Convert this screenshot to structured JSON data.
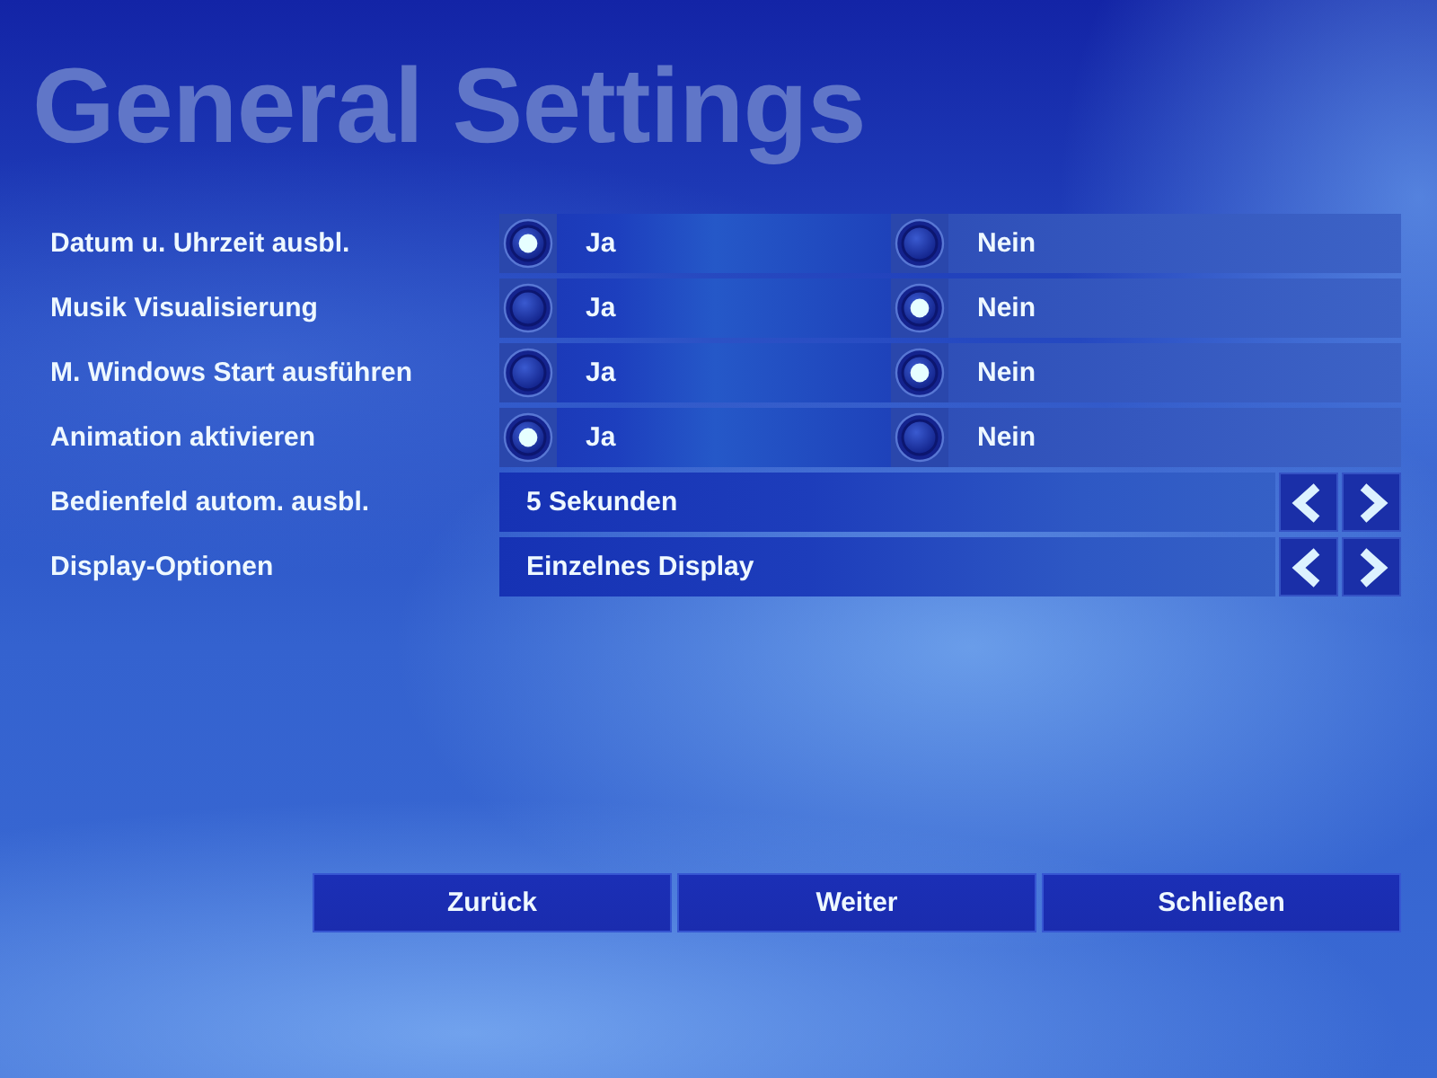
{
  "title": "General Settings",
  "settings": [
    {
      "kind": "radio",
      "label": "Datum u. Uhrzeit ausbl.",
      "options": [
        {
          "label": "Ja",
          "selected": true
        },
        {
          "label": "Nein",
          "selected": false
        }
      ]
    },
    {
      "kind": "radio",
      "label": "Musik Visualisierung",
      "options": [
        {
          "label": "Ja",
          "selected": false
        },
        {
          "label": "Nein",
          "selected": true
        }
      ]
    },
    {
      "kind": "radio",
      "label": "M. Windows Start ausführen",
      "options": [
        {
          "label": "Ja",
          "selected": false
        },
        {
          "label": "Nein",
          "selected": true
        }
      ]
    },
    {
      "kind": "radio",
      "label": "Animation aktivieren",
      "options": [
        {
          "label": "Ja",
          "selected": true
        },
        {
          "label": "Nein",
          "selected": false
        }
      ]
    },
    {
      "kind": "spinner",
      "label": "Bedienfeld autom. ausbl.",
      "value": "5 Sekunden"
    },
    {
      "kind": "spinner",
      "label": "Display-Optionen",
      "value": "Einzelnes Display"
    }
  ],
  "buttons": [
    "Zurück",
    "Weiter",
    "Schließen"
  ]
}
